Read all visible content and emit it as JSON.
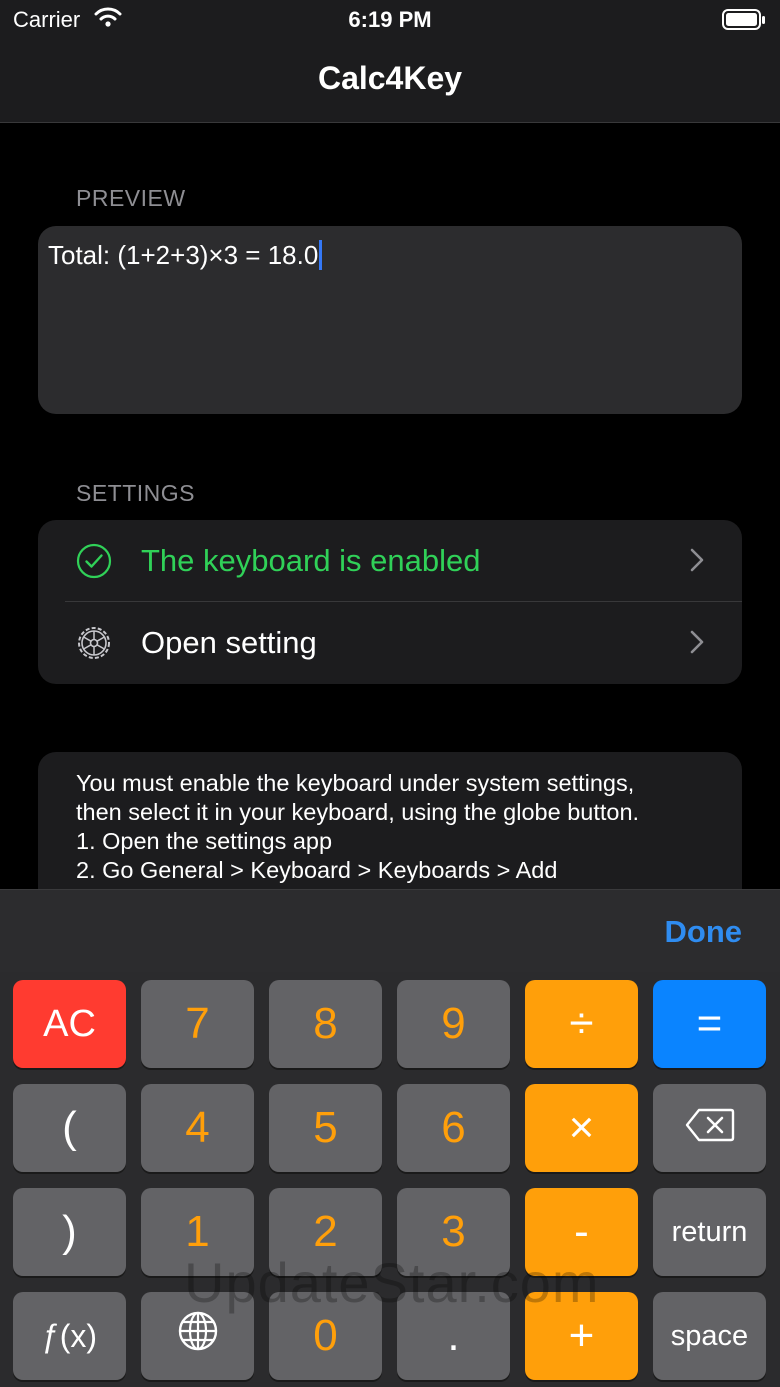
{
  "status_bar": {
    "carrier": "Carrier",
    "time": "6:19 PM"
  },
  "nav": {
    "title": "Calc4Key"
  },
  "preview": {
    "section_label": "PREVIEW",
    "text": "Total: (1+2+3)×3 = 18.0"
  },
  "settings": {
    "section_label": "SETTINGS",
    "rows": [
      {
        "label": "The keyboard is enabled",
        "color": "#30d158",
        "icon": "checkmark-circle-icon"
      },
      {
        "label": "Open setting",
        "color": "#ffffff",
        "icon": "gear-icon"
      }
    ]
  },
  "info": {
    "lines": [
      "You must enable the keyboard under system settings,",
      "then select it in your keyboard, using the globe button.",
      "1. Open the settings app",
      "2. Go General > Keyboard > Keyboards > Add"
    ]
  },
  "keyboard": {
    "done_label": "Done",
    "keys": {
      "ac": "AC",
      "seven": "7",
      "eight": "8",
      "nine": "9",
      "divide": "÷",
      "equals": "=",
      "open_paren": "(",
      "four": "4",
      "five": "5",
      "six": "6",
      "multiply": "×",
      "close_paren": ")",
      "one": "1",
      "two": "2",
      "three": "3",
      "minus": "-",
      "return": "return",
      "fx": "ƒ(x)",
      "zero": "0",
      "dot": ".",
      "plus": "+",
      "space": "space"
    }
  },
  "watermark": "UpdateStar.com",
  "colors": {
    "accent_blue": "#0a84ff",
    "operator_orange": "#ff9f0a",
    "clear_red": "#ff3b30",
    "enabled_green": "#30d158"
  }
}
